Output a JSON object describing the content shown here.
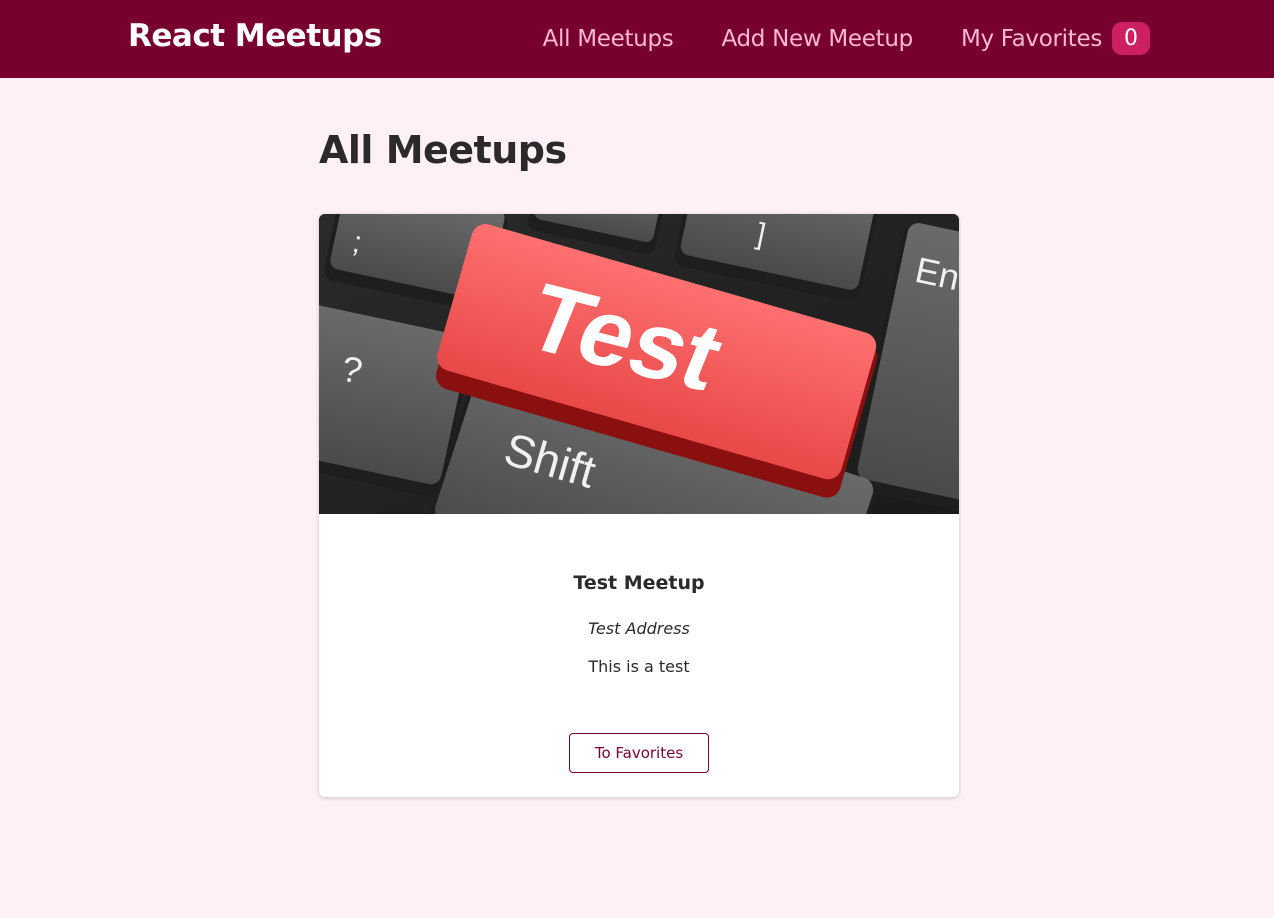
{
  "header": {
    "logo": "React Meetups",
    "nav": {
      "all_meetups": "All Meetups",
      "add_new_meetup": "Add New Meetup",
      "my_favorites": "My Favorites",
      "favorites_count": "0"
    }
  },
  "main": {
    "title": "All Meetups",
    "meetups": [
      {
        "title": "Test Meetup",
        "address": "Test Address",
        "description": "This is a test",
        "favorite_button": "To Favorites",
        "image": {
          "big_key_text": "Test",
          "shift_key_text": "Shift",
          "question_key_text": "?",
          "enter_key_text": "En",
          "bracket_key_text": "]",
          "semicolon_key_text": ";"
        }
      }
    ]
  },
  "colors": {
    "header_bg": "#77002e",
    "nav_link": "#fcb8d2",
    "badge_bg": "#cc2062",
    "page_bg": "#fdf1f5",
    "accent": "#77002e"
  }
}
